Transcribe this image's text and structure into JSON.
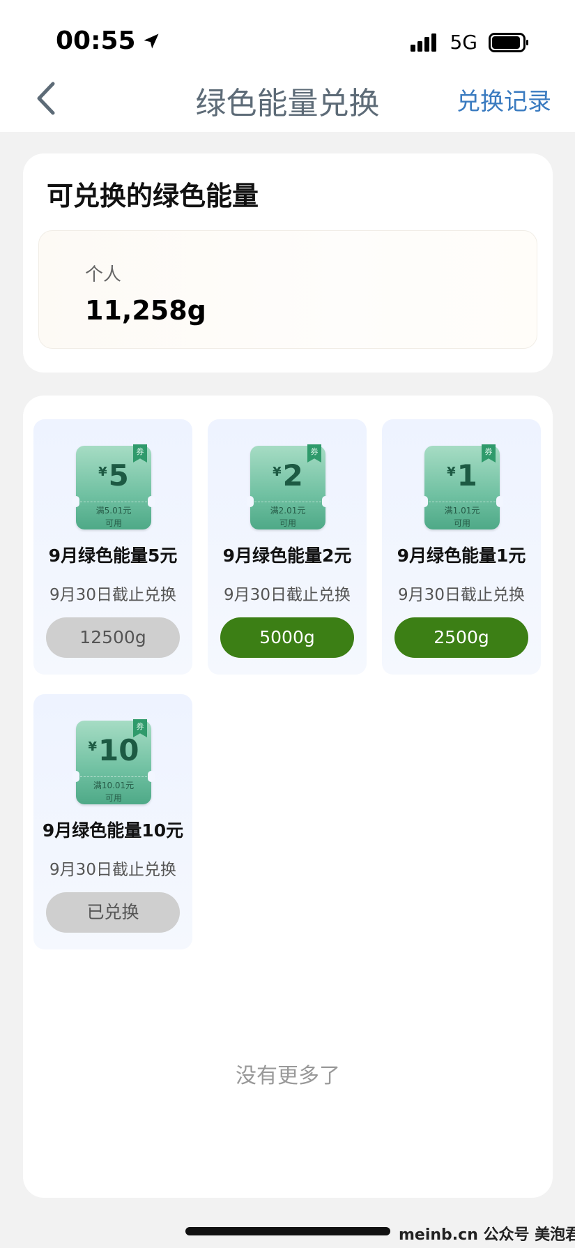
{
  "status_bar": {
    "time": "00:55",
    "network": "5G"
  },
  "nav": {
    "title": "绿色能量兑换",
    "history_link": "兑换记录"
  },
  "balance": {
    "title": "可兑换的绿色能量",
    "label": "个人",
    "value": "11,258g"
  },
  "coupons": [
    {
      "currency": "¥",
      "amount": "5",
      "condition_line1": "满5.01元",
      "condition_line2": "可用",
      "ribbon": "券",
      "name": "9月绿色能量5元",
      "deadline": "9月30日截止兑换",
      "button": "12500g",
      "state": "disabled"
    },
    {
      "currency": "¥",
      "amount": "2",
      "condition_line1": "满2.01元",
      "condition_line2": "可用",
      "ribbon": "券",
      "name": "9月绿色能量2元",
      "deadline": "9月30日截止兑换",
      "button": "5000g",
      "state": "available"
    },
    {
      "currency": "¥",
      "amount": "1",
      "condition_line1": "满1.01元",
      "condition_line2": "可用",
      "ribbon": "券",
      "name": "9月绿色能量1元",
      "deadline": "9月30日截止兑换",
      "button": "2500g",
      "state": "available"
    },
    {
      "currency": "¥",
      "amount": "10",
      "condition_line1": "满10.01元",
      "condition_line2": "可用",
      "ribbon": "券",
      "name": "9月绿色能量10元",
      "deadline": "9月30日截止兑换",
      "button": "已兑换",
      "state": "redeemed"
    }
  ],
  "footer": {
    "no_more": "没有更多了",
    "watermark": "meinb.cn  公众号 美泡君"
  },
  "colors": {
    "accent_green": "#3c7f15",
    "link_blue": "#3a7bc0",
    "disabled_gray": "#cfcfcf"
  },
  "icons": [
    "location-arrow-icon",
    "signal-icon",
    "battery-icon",
    "back-chevron-icon"
  ]
}
